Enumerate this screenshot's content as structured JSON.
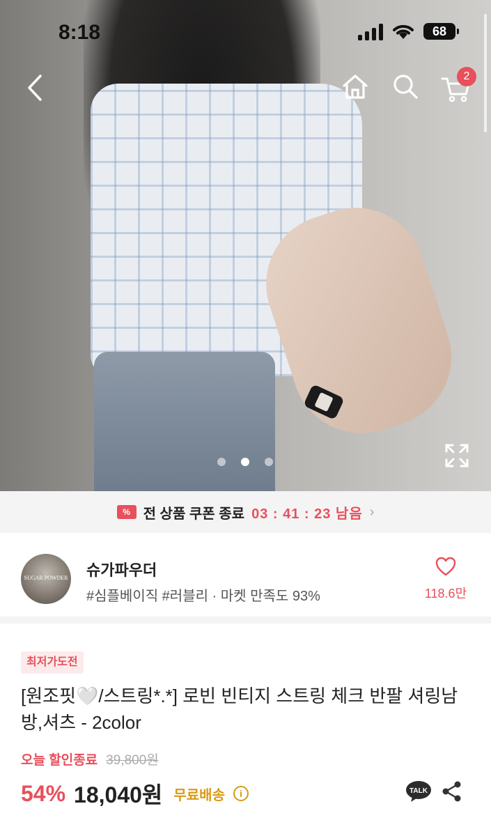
{
  "status_bar": {
    "time": "8:18",
    "battery": "68"
  },
  "nav": {
    "cart_count": "2"
  },
  "carousel": {
    "total": 3,
    "active": 2
  },
  "coupon": {
    "label": "전 상품 쿠폰 종료",
    "timer": "03 : 41 : 23 남음"
  },
  "seller": {
    "name": "슈가파우더",
    "avatar_text": "SUGAR POWDER",
    "description": "#심플베이직 #러블리 · 마켓 만족도 93%",
    "favorites": "118.6만"
  },
  "product": {
    "badge": "최저가도전",
    "title": "[원조핏🤍/스트링*.*] 로빈 빈티지 스트링 체크 반팔 셔링남방,셔츠 - 2color",
    "sale_label": "오늘 할인종료",
    "original_price": "39,800원",
    "discount": "54%",
    "price": "18,040원",
    "shipping": "무료배송",
    "info_icon": "i"
  },
  "icons": {
    "back": "back-arrow-icon",
    "home": "home-icon",
    "search": "search-icon",
    "cart": "cart-icon",
    "expand": "expand-icon",
    "coupon": "coupon-icon",
    "heart": "heart-icon",
    "talk": "kakao-talk-icon",
    "share": "share-icon"
  },
  "talk_label": "TALK",
  "colors": {
    "accent": "#e8505b",
    "shipping": "#d99a14",
    "talk": "#2b2b2b"
  }
}
